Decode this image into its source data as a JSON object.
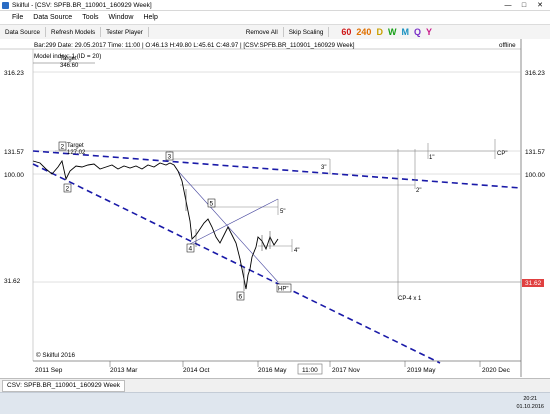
{
  "window": {
    "title": "Skilful - [CSV: SPFB.BR_110901_160929 Week]"
  },
  "menu": [
    "File",
    "Data Source",
    "Tools",
    "Window",
    "Help"
  ],
  "toolbar": {
    "buttons": [
      "Data Source",
      "Refresh Models",
      "Tester Player",
      "Remove All",
      "Skip Scaling"
    ],
    "timeframes": [
      {
        "label": "60",
        "color": "#d01818"
      },
      {
        "label": "240",
        "color": "#e07000"
      },
      {
        "label": "D",
        "color": "#c8a000"
      },
      {
        "label": "W",
        "color": "#18a018"
      },
      {
        "label": "M",
        "color": "#1890c0"
      },
      {
        "label": "Q",
        "color": "#7a30c8"
      },
      {
        "label": "Y",
        "color": "#c81888"
      }
    ]
  },
  "infobar": {
    "text": "Bar:299  Date:  29.05.2017  Time:  11:00  |  O:46.13  H:49.80  L:45.61  C:48.97  |  [CSV:SPFB.BR_110901_160929 Week]",
    "status": "offline"
  },
  "model_info": "Model index: 1 (ID = 20)",
  "price_axis": {
    "labels": [
      "316.23",
      "131.57",
      "100.00",
      "31.62"
    ],
    "current_price": "31.62"
  },
  "time_axis": {
    "labels": [
      "2011 Sep",
      "2013 Mar",
      "2014 Oct",
      "2016 May",
      "11:00",
      "2017 Nov",
      "2019 May",
      "2020 Dec"
    ]
  },
  "annotations": {
    "target1": "Target",
    "target1_value": "346.60",
    "target2": "Target",
    "target2_value": "127.02",
    "points": [
      "2",
      "2",
      "3",
      "4",
      "5",
      "6"
    ],
    "labels": [
      "3\"",
      "5\"",
      "4\"",
      "2\"",
      "1\"",
      "CP\"",
      "HP\"",
      "CP-4 x 1"
    ]
  },
  "copyright": "© Skilful 2016",
  "status_tab": "CSV: SPFB.BR_110901_160929 Week",
  "taskbar": {
    "time": "20:21",
    "date": "01.10.2016"
  }
}
